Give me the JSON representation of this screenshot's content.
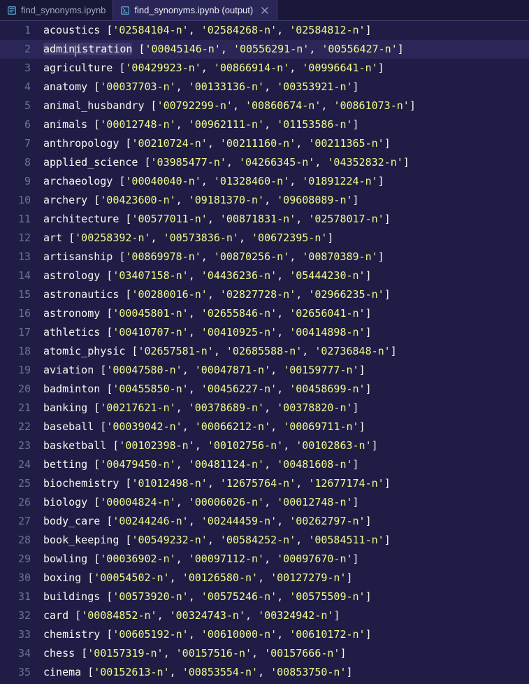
{
  "tabs": [
    {
      "label": "find_synonyms.ipynb",
      "icon": "file-notebook-icon",
      "active": false,
      "closeable": false
    },
    {
      "label": "find_synonyms.ipynb (output)",
      "icon": "file-output-icon",
      "active": true,
      "closeable": true
    }
  ],
  "editor": {
    "highlight_line_index": 1,
    "selection": {
      "line_index": 1,
      "word": "administration"
    },
    "lines": [
      {
        "n": 1,
        "ident": "acoustics",
        "ids": [
          "02584104-n",
          "02584268-n",
          "02584812-n"
        ]
      },
      {
        "n": 2,
        "ident": "administration",
        "ids": [
          "00045146-n",
          "00556291-n",
          "00556427-n"
        ]
      },
      {
        "n": 3,
        "ident": "agriculture",
        "ids": [
          "00429923-n",
          "00866914-n",
          "00996641-n"
        ]
      },
      {
        "n": 4,
        "ident": "anatomy",
        "ids": [
          "00037703-n",
          "00133136-n",
          "00353921-n"
        ]
      },
      {
        "n": 5,
        "ident": "animal_husbandry",
        "ids": [
          "00792299-n",
          "00860674-n",
          "00861073-n"
        ]
      },
      {
        "n": 6,
        "ident": "animals",
        "ids": [
          "00012748-n",
          "00962111-n",
          "01153586-n"
        ]
      },
      {
        "n": 7,
        "ident": "anthropology",
        "ids": [
          "00210724-n",
          "00211160-n",
          "00211365-n"
        ]
      },
      {
        "n": 8,
        "ident": "applied_science",
        "ids": [
          "03985477-n",
          "04266345-n",
          "04352832-n"
        ]
      },
      {
        "n": 9,
        "ident": "archaeology",
        "ids": [
          "00040040-n",
          "01328460-n",
          "01891224-n"
        ]
      },
      {
        "n": 10,
        "ident": "archery",
        "ids": [
          "00423600-n",
          "09181370-n",
          "09608089-n"
        ]
      },
      {
        "n": 11,
        "ident": "architecture",
        "ids": [
          "00577011-n",
          "00871831-n",
          "02578017-n"
        ]
      },
      {
        "n": 12,
        "ident": "art",
        "ids": [
          "00258392-n",
          "00573836-n",
          "00672395-n"
        ]
      },
      {
        "n": 13,
        "ident": "artisanship",
        "ids": [
          "00869978-n",
          "00870256-n",
          "00870389-n"
        ]
      },
      {
        "n": 14,
        "ident": "astrology",
        "ids": [
          "03407158-n",
          "04436236-n",
          "05444230-n"
        ]
      },
      {
        "n": 15,
        "ident": "astronautics",
        "ids": [
          "00280016-n",
          "02827728-n",
          "02966235-n"
        ]
      },
      {
        "n": 16,
        "ident": "astronomy",
        "ids": [
          "00045801-n",
          "02655846-n",
          "02656041-n"
        ]
      },
      {
        "n": 17,
        "ident": "athletics",
        "ids": [
          "00410707-n",
          "00410925-n",
          "00414898-n"
        ]
      },
      {
        "n": 18,
        "ident": "atomic_physic",
        "ids": [
          "02657581-n",
          "02685588-n",
          "02736848-n"
        ]
      },
      {
        "n": 19,
        "ident": "aviation",
        "ids": [
          "00047580-n",
          "00047871-n",
          "00159777-n"
        ]
      },
      {
        "n": 20,
        "ident": "badminton",
        "ids": [
          "00455850-n",
          "00456227-n",
          "00458699-n"
        ]
      },
      {
        "n": 21,
        "ident": "banking",
        "ids": [
          "00217621-n",
          "00378689-n",
          "00378820-n"
        ]
      },
      {
        "n": 22,
        "ident": "baseball",
        "ids": [
          "00039042-n",
          "00066212-n",
          "00069711-n"
        ]
      },
      {
        "n": 23,
        "ident": "basketball",
        "ids": [
          "00102398-n",
          "00102756-n",
          "00102863-n"
        ]
      },
      {
        "n": 24,
        "ident": "betting",
        "ids": [
          "00479450-n",
          "00481124-n",
          "00481608-n"
        ]
      },
      {
        "n": 25,
        "ident": "biochemistry",
        "ids": [
          "01012498-n",
          "12675764-n",
          "12677174-n"
        ]
      },
      {
        "n": 26,
        "ident": "biology",
        "ids": [
          "00004824-n",
          "00006026-n",
          "00012748-n"
        ]
      },
      {
        "n": 27,
        "ident": "body_care",
        "ids": [
          "00244246-n",
          "00244459-n",
          "00262797-n"
        ]
      },
      {
        "n": 28,
        "ident": "book_keeping",
        "ids": [
          "00549232-n",
          "00584252-n",
          "00584511-n"
        ]
      },
      {
        "n": 29,
        "ident": "bowling",
        "ids": [
          "00036902-n",
          "00097112-n",
          "00097670-n"
        ]
      },
      {
        "n": 30,
        "ident": "boxing",
        "ids": [
          "00054502-n",
          "00126580-n",
          "00127279-n"
        ]
      },
      {
        "n": 31,
        "ident": "buildings",
        "ids": [
          "00573920-n",
          "00575246-n",
          "00575509-n"
        ]
      },
      {
        "n": 32,
        "ident": "card",
        "ids": [
          "00084852-n",
          "00324743-n",
          "00324942-n"
        ]
      },
      {
        "n": 33,
        "ident": "chemistry",
        "ids": [
          "00605192-n",
          "00610000-n",
          "00610172-n"
        ]
      },
      {
        "n": 34,
        "ident": "chess",
        "ids": [
          "00157319-n",
          "00157516-n",
          "00157666-n"
        ]
      },
      {
        "n": 35,
        "ident": "cinema",
        "ids": [
          "00152613-n",
          "00853554-n",
          "00853750-n"
        ]
      }
    ]
  },
  "colors": {
    "bg": "#1f1d45",
    "accent": "#bd93f9",
    "string": "#f1fa8c",
    "identifier": "#c2e885"
  }
}
